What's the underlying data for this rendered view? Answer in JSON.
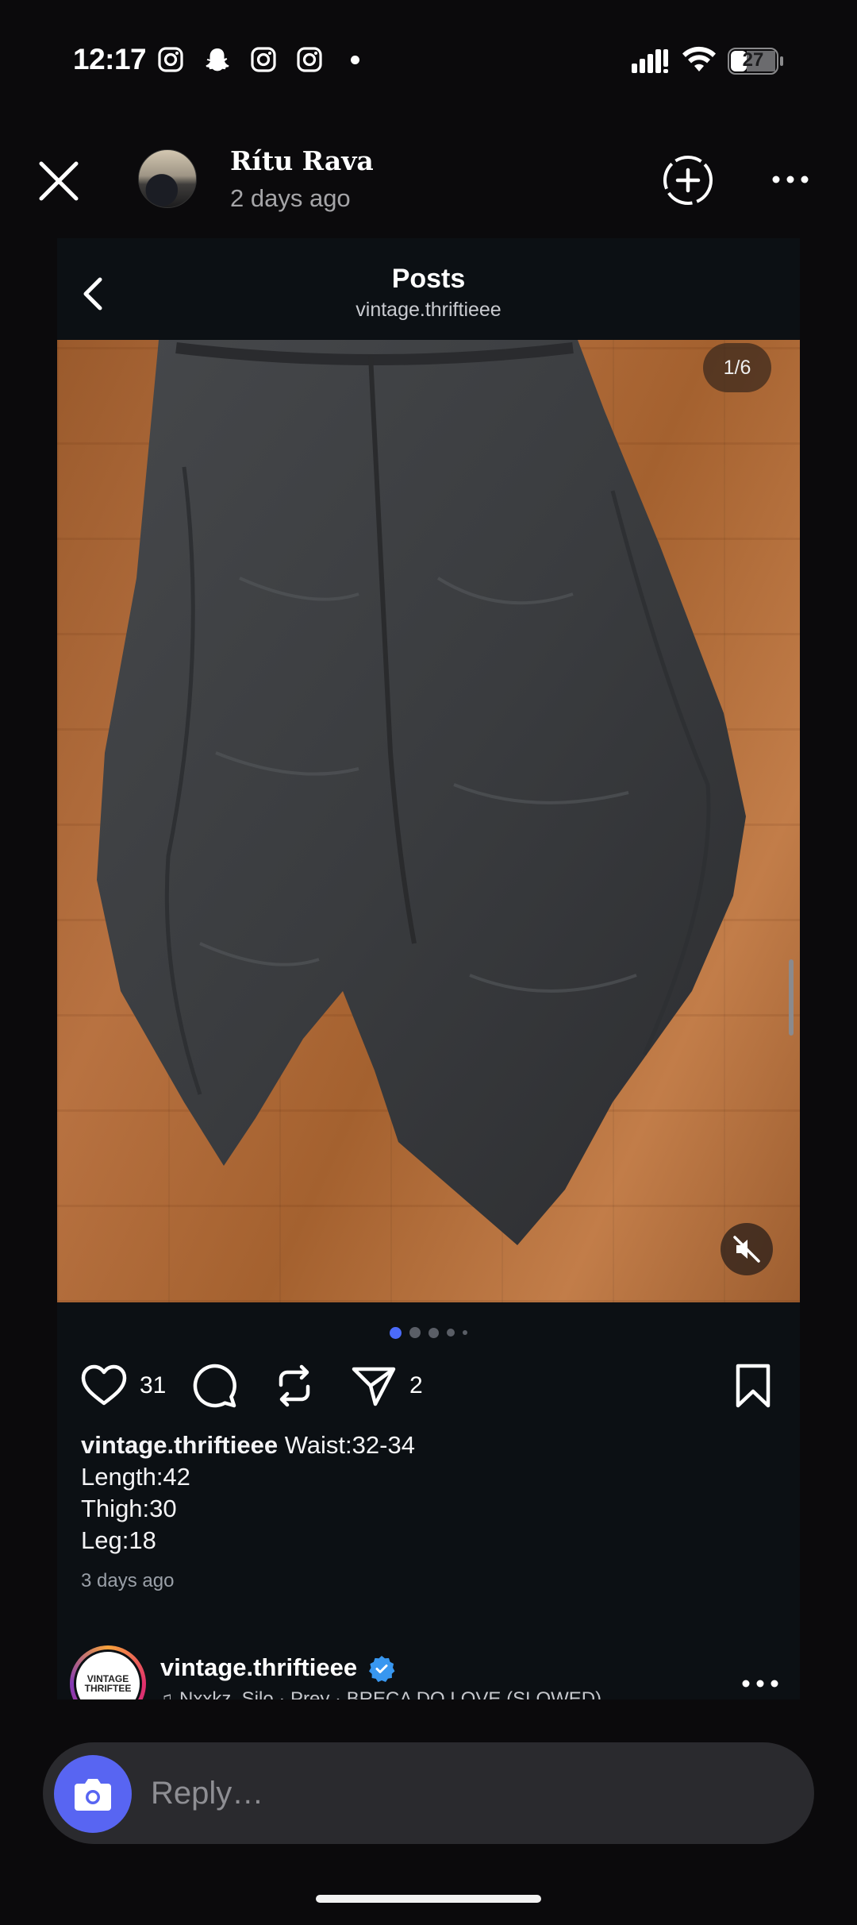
{
  "status_bar": {
    "time": "12:17",
    "battery": "27",
    "notification_icons": [
      "instagram-icon",
      "snapchat-icon",
      "instagram-icon",
      "instagram-icon",
      "dot-icon"
    ]
  },
  "story": {
    "username": "Rítu Rava",
    "time_ago": "2 days ago"
  },
  "post_card": {
    "header_title": "Posts",
    "header_subtitle": "vintage.thriftieee",
    "page_counter": "1/6",
    "likes": "31",
    "shares": "2",
    "caption_user": "vintage.thriftieee",
    "caption_lines": [
      "Waist:32-34",
      "Length:42",
      "Thigh:30",
      "Leg:18"
    ],
    "date": "3 days ago",
    "next_post": {
      "username": "vintage.thriftieee",
      "avatar_text": "VINTAGE THRIFTEE",
      "song": "Nxxkz, Silo · Prey · BRECA DO LOVE (SLOWED)"
    }
  },
  "reply": {
    "placeholder": "Reply…"
  },
  "colors": {
    "background": "#0b0a0c",
    "card": "#0c1014",
    "accent_camera": "#5865f2",
    "active_dot": "#4b6bfb",
    "verified": "#3897f0"
  }
}
